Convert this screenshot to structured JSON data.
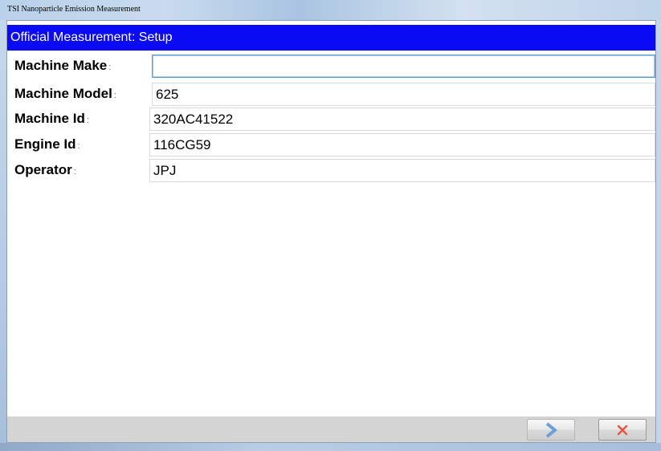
{
  "window": {
    "title": "TSI Nanoparticle Emission Measurement"
  },
  "header": {
    "title": "Official Measurement: Setup",
    "background_color": "#0a0af5"
  },
  "form": {
    "fields": [
      {
        "label": "Machine Make",
        "colon": ":",
        "value": ""
      },
      {
        "label": "Machine Model",
        "colon": ":",
        "value": "625"
      },
      {
        "label": "Machine Id",
        "colon": ":",
        "value": "320AC41522"
      },
      {
        "label": "Engine Id",
        "colon": ":",
        "value": "116CG59"
      },
      {
        "label": "Operator",
        "colon": ":",
        "value": "JPJ"
      }
    ]
  },
  "buttons": {
    "next": {
      "icon": "chevron-right-icon",
      "color": "#6f9fd8"
    },
    "cancel": {
      "icon": "close-icon",
      "color": "#e8553e"
    }
  }
}
